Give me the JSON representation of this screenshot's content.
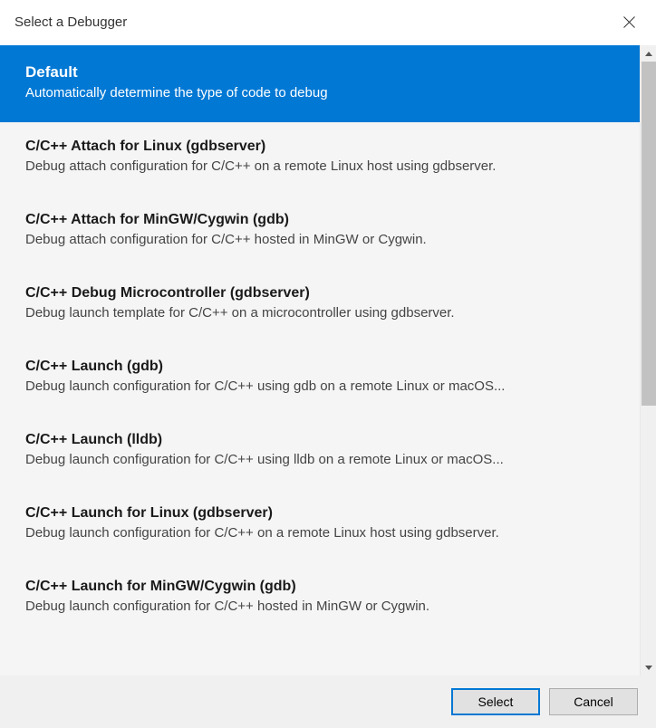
{
  "dialog": {
    "title": "Select a Debugger"
  },
  "items": [
    {
      "title": "Default",
      "desc": "Automatically determine the type of code to debug",
      "selected": true
    },
    {
      "title": "C/C++ Attach for Linux (gdbserver)",
      "desc": "Debug attach configuration for C/C++ on a remote Linux host using gdbserver.",
      "selected": false
    },
    {
      "title": "C/C++ Attach for MinGW/Cygwin (gdb)",
      "desc": "Debug attach configuration for C/C++ hosted in MinGW or Cygwin.",
      "selected": false
    },
    {
      "title": "C/C++ Debug Microcontroller (gdbserver)",
      "desc": "Debug launch template for C/C++ on a microcontroller using gdbserver.",
      "selected": false
    },
    {
      "title": "C/C++ Launch (gdb)",
      "desc": "Debug launch configuration for C/C++ using gdb on a remote Linux or macOS...",
      "selected": false
    },
    {
      "title": "C/C++ Launch (lldb)",
      "desc": "Debug launch configuration for C/C++ using lldb on a remote Linux or macOS...",
      "selected": false
    },
    {
      "title": "C/C++ Launch for Linux (gdbserver)",
      "desc": "Debug launch configuration for C/C++ on a remote Linux host using gdbserver.",
      "selected": false
    },
    {
      "title": "C/C++ Launch for MinGW/Cygwin (gdb)",
      "desc": "Debug launch configuration for C/C++ hosted in MinGW or Cygwin.",
      "selected": false
    }
  ],
  "buttons": {
    "select": "Select",
    "cancel": "Cancel"
  }
}
